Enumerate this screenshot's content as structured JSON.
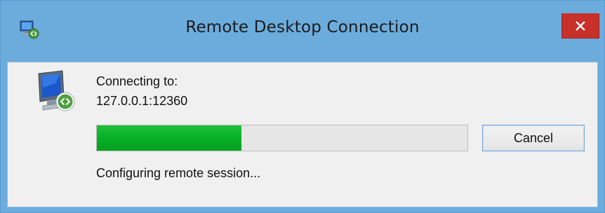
{
  "window": {
    "title": "Remote Desktop Connection",
    "app_icon": "remote-desktop-icon",
    "close_icon": "close-icon"
  },
  "connection": {
    "connecting_label": "Connecting to:",
    "address": "127.0.0.1:12360",
    "status": "Configuring remote session...",
    "progress_fraction": 0.39
  },
  "buttons": {
    "cancel_label": "Cancel"
  },
  "colors": {
    "titlebar": "#6cacdd",
    "close_button": "#c7312a",
    "progress_fill": "#06b025",
    "progress_track": "#e6e6e6"
  }
}
